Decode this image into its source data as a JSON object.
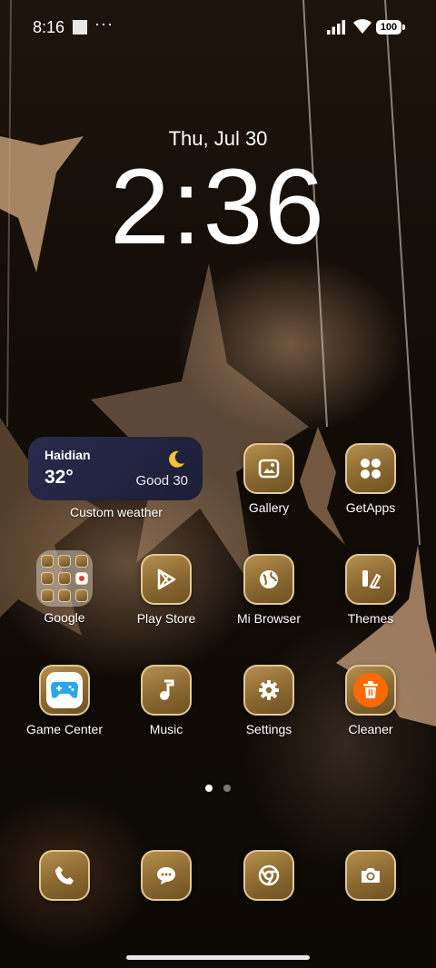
{
  "status_bar": {
    "time": "8:16",
    "more": "···",
    "battery": "100",
    "icons": [
      "square-notification-icon",
      "signal-icon",
      "wifi-icon",
      "battery-icon"
    ]
  },
  "clock": {
    "date": "Thu, Jul 30",
    "time": "2:36"
  },
  "weather_widget": {
    "location": "Haidian",
    "temperature": "32°",
    "air_quality": "Good 30",
    "label": "Custom weather",
    "icon": "moon-icon"
  },
  "apps": {
    "gallery": "Gallery",
    "getapps": "GetApps",
    "google": "Google",
    "play_store": "Play Store",
    "mi_browser": "Mi Browser",
    "themes": "Themes",
    "game_center": "Game Center",
    "music": "Music",
    "settings": "Settings",
    "cleaner": "Cleaner"
  },
  "dock": [
    "phone-icon",
    "messages-icon",
    "chrome-icon",
    "camera-icon"
  ],
  "pager": {
    "pages": 2,
    "current": 1
  },
  "colors": {
    "icon_gold": "#8a6830",
    "icon_border": "#ebd2a0",
    "weather_bg": "#2a2b4d",
    "cleaner_orange": "#ff6a00",
    "game_blue": "#2aa7e8"
  }
}
